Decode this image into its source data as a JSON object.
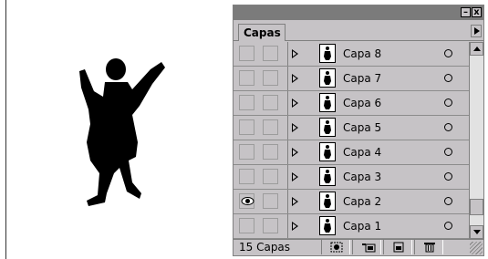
{
  "panel": {
    "tab_label": "Capas",
    "minimize_label": "–",
    "close_label": "x",
    "layers": [
      {
        "name": "Capa 8",
        "visible": false
      },
      {
        "name": "Capa 7",
        "visible": false
      },
      {
        "name": "Capa 6",
        "visible": false
      },
      {
        "name": "Capa 5",
        "visible": false
      },
      {
        "name": "Capa 4",
        "visible": false
      },
      {
        "name": "Capa 3",
        "visible": false
      },
      {
        "name": "Capa 2",
        "visible": true
      },
      {
        "name": "Capa 1",
        "visible": false
      }
    ],
    "layer_count": "15 Capas",
    "bottom_icons": [
      "mask-icon",
      "new-set-icon",
      "new-layer-icon",
      "trash-icon"
    ]
  }
}
